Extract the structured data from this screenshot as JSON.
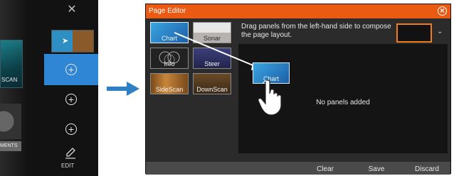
{
  "left_screen": {
    "sonar_tile_label": "SCAN",
    "gauge_tile_label": "MENTS",
    "edit_label": "EDIT"
  },
  "editor": {
    "title": "Page Editor",
    "instruction": "Drag panels from the left-hand side to compose the page layout.",
    "panels": [
      {
        "label": "Chart"
      },
      {
        "label": "Sonar"
      },
      {
        "label": "Info"
      },
      {
        "label": "Steer"
      },
      {
        "label": "SideScan"
      },
      {
        "label": "DownScan"
      }
    ],
    "dragged_panel_label": "Chart",
    "empty_message": "No panels added",
    "buttons": {
      "clear": "Clear",
      "save": "Save",
      "discard": "Discard"
    }
  },
  "colors": {
    "accent": "#ea5a12",
    "selected_blue": "#2f86d4",
    "layout_border": "#f07c1a"
  },
  "icons": {
    "close": "close-icon",
    "plus": "plus-icon",
    "pencil": "pencil-icon",
    "arrow": "arrow-right-icon",
    "hand": "hand-pointer-icon",
    "chevron": "chevron-down-icon"
  }
}
